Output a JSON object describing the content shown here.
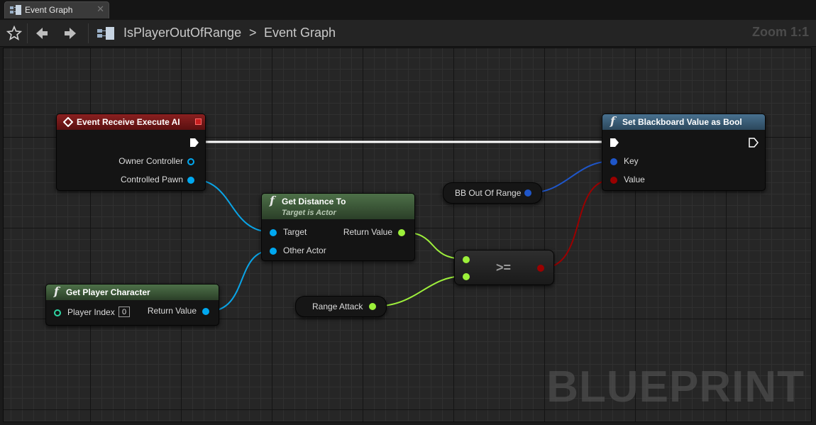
{
  "tab": {
    "label": "Event Graph",
    "close": "✕"
  },
  "toolbar": {
    "breadcrumb_root": "IsPlayerOutOfRange",
    "breadcrumb_separator": ">",
    "breadcrumb_current": "Event Graph",
    "zoom": "Zoom 1:1"
  },
  "nodes": {
    "event_execute": {
      "title": "Event Receive Execute AI",
      "pin_owner": "Owner Controller",
      "pin_pawn": "Controlled Pawn"
    },
    "set_bb": {
      "title": "Set Blackboard Value as Bool",
      "pin_key": "Key",
      "pin_value": "Value"
    },
    "bb_out_of_range": {
      "label": "BB Out Of Range"
    },
    "get_distance": {
      "title": "Get Distance To",
      "subtitle": "Target is Actor",
      "pin_target": "Target",
      "pin_other": "Other Actor",
      "pin_return": "Return Value"
    },
    "compare": {
      "label": ">="
    },
    "get_player": {
      "title": "Get Player Character",
      "pin_index": "Player Index",
      "index_value": "0",
      "pin_return": "Return Value"
    },
    "range_attack": {
      "label": "Range Attack"
    }
  },
  "watermark": "BLUEPRINT",
  "colors": {
    "event_header": "#7a1c1c",
    "function_header_blue": "#3b5f78",
    "function_header_green": "#3f5f3a",
    "object_pin": "#00a8f0",
    "float_pin": "#9cf03a",
    "bool_pin": "#950000",
    "exec_wire": "#ffffff"
  }
}
